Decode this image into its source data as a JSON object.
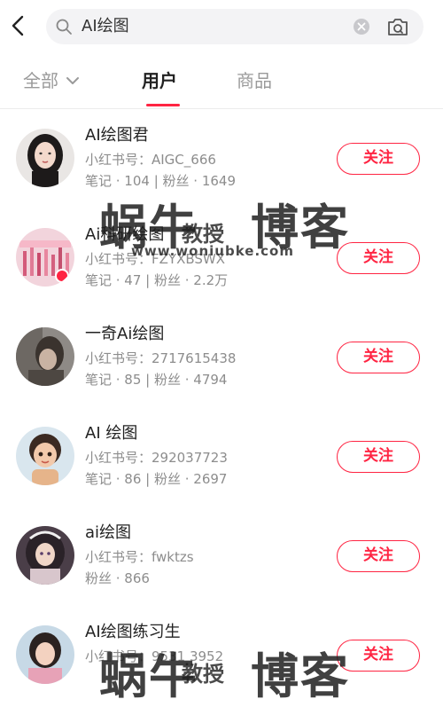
{
  "search": {
    "query": "AI绘图"
  },
  "tabs": [
    {
      "label": "全部"
    },
    {
      "label": "用户"
    },
    {
      "label": "商品"
    }
  ],
  "users": [
    {
      "name": "AI绘图君",
      "id_line": "小红书号：AIGC_666",
      "stats_line": "笔记 · 104 | 粉丝 · 1649",
      "follow_label": "关注"
    },
    {
      "name": "Ai科研绘图",
      "id_line": "小红书号：FZYXBSWX",
      "stats_line": "笔记 · 47 | 粉丝 · 2.2万",
      "follow_label": "关注"
    },
    {
      "name": "一奇Ai绘图",
      "id_line": "小红书号：2717615438",
      "stats_line": "笔记 · 85 | 粉丝 · 4794",
      "follow_label": "关注"
    },
    {
      "name": "AI 绘图",
      "id_line": "小红书号：292037723",
      "stats_line": "笔记 · 86 | 粉丝 · 2697",
      "follow_label": "关注"
    },
    {
      "name": "ai绘图",
      "id_line": "小红书号：fwktzs",
      "stats_line": "粉丝 · 866",
      "follow_label": "关注"
    },
    {
      "name": "AI绘图练习生",
      "id_line": "小红书号：9531 3952",
      "stats_line": "",
      "follow_label": "关注"
    }
  ],
  "watermark": {
    "brand": "蜗牛",
    "mid": "教授",
    "brand2": "博客",
    "url": "www.woniubke.com"
  },
  "colors": {
    "accent": "#ff2442",
    "text_primary": "#222222",
    "text_secondary": "#8d8d8d"
  }
}
